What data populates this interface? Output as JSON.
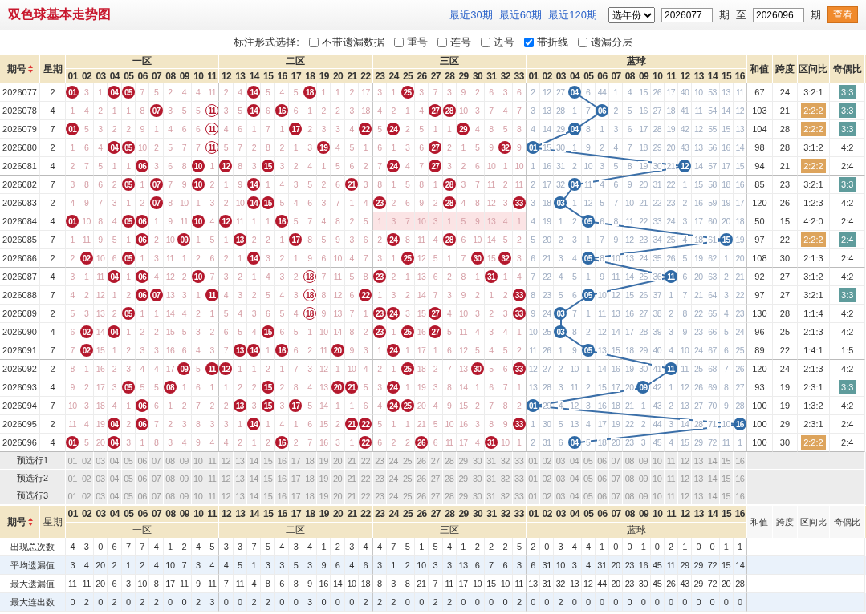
{
  "title": "双色球基本走势图",
  "range_links": [
    "最近30期",
    "最近60期",
    "最近120期"
  ],
  "year_select": "选年份",
  "from": {
    "value": "2026077",
    "unit": "期"
  },
  "to": {
    "label": "至",
    "value": "2026096",
    "unit": "期"
  },
  "view_button": "查看",
  "options": {
    "label": "标注形式选择:",
    "items": [
      {
        "label": "不带遗漏数据",
        "checked": false
      },
      {
        "label": "重号",
        "checked": false
      },
      {
        "label": "连号",
        "checked": false
      },
      {
        "label": "边号",
        "checked": false
      },
      {
        "label": "带折线",
        "checked": true
      },
      {
        "label": "遗漏分层",
        "checked": false
      }
    ]
  },
  "header": {
    "period": "期号",
    "weekday": "星期",
    "zones": [
      {
        "name": "一区",
        "numbers": [
          "01",
          "02",
          "03",
          "04",
          "05",
          "06",
          "07",
          "08",
          "09",
          "10",
          "11"
        ]
      },
      {
        "name": "二区",
        "numbers": [
          "12",
          "13",
          "14",
          "15",
          "16",
          "17",
          "18",
          "19",
          "20",
          "21",
          "22"
        ]
      },
      {
        "name": "三区",
        "numbers": [
          "23",
          "24",
          "25",
          "26",
          "27",
          "28",
          "29",
          "30",
          "31",
          "32",
          "33"
        ]
      },
      {
        "name": "蓝球",
        "numbers": [
          "01",
          "02",
          "03",
          "04",
          "05",
          "06",
          "07",
          "08",
          "09",
          "10",
          "11",
          "12",
          "13",
          "14",
          "15",
          "16"
        ]
      }
    ],
    "sum": "和值",
    "span": "跨度",
    "zone_ratio": "区间比",
    "odd_even": "奇偶比"
  },
  "rows": [
    {
      "period": "2026077",
      "weekday": "2",
      "red": [
        {
          "ball": "01",
          "ring": false
        },
        "3",
        "1",
        {
          "ball": "04",
          "ring": false
        },
        {
          "ball": "05",
          "ring": false
        },
        "7",
        "5",
        "2",
        "4",
        "4",
        "11",
        "2",
        "4",
        {
          "ball": "14",
          "ring": false
        },
        "5",
        "4",
        "5",
        {
          "ball": "18",
          "ring": false
        },
        "1",
        "1",
        "2",
        "17",
        "3",
        "1",
        {
          "ball": "25",
          "ring": false
        },
        "3",
        "7",
        "3",
        "9",
        "2",
        "6",
        "3",
        "6"
      ],
      "blue": [
        "2",
        "12",
        "27",
        {
          "ball": "04"
        },
        "6",
        "44",
        "1",
        "4",
        "15",
        "26",
        "17",
        "40",
        "10",
        "53",
        "13",
        "11"
      ],
      "blank_zone_3": false,
      "sum": "67",
      "span": "24",
      "zone_ratio": {
        "text": "3:2:1",
        "highlight": false
      },
      "odd_even": {
        "text": "3:3",
        "highlight": true
      }
    },
    {
      "period": "2026078",
      "weekday": "4",
      "red": [
        "1",
        "4",
        "2",
        "1",
        "1",
        "8",
        {
          "ball": "07",
          "ring": false
        },
        "3",
        "5",
        "5",
        {
          "ball": "11",
          "ring": true
        },
        "3",
        "5",
        {
          "ball": "14",
          "ring": false
        },
        "6",
        {
          "ball": "16",
          "ring": false
        },
        "6",
        "1",
        "2",
        "2",
        "3",
        "18",
        "4",
        "2",
        "1",
        "4",
        {
          "ball": "27",
          "ring": false
        },
        {
          "ball": "28",
          "ring": false
        },
        "10",
        "3",
        "7",
        "4",
        "7"
      ],
      "blue": [
        "3",
        "13",
        "28",
        "1",
        "7",
        {
          "ball": "06"
        },
        "2",
        "5",
        "16",
        "27",
        "18",
        "41",
        "11",
        "54",
        "14",
        "12"
      ],
      "blank_zone_3": false,
      "sum": "103",
      "span": "21",
      "zone_ratio": {
        "text": "2:2:2",
        "highlight": true
      },
      "odd_even": {
        "text": "3:3",
        "highlight": true
      }
    },
    {
      "period": "2026079",
      "weekday": "7",
      "red": [
        {
          "ball": "01",
          "ring": false
        },
        "5",
        "3",
        "2",
        "2",
        "9",
        "1",
        "4",
        "6",
        "6",
        {
          "ball": "11",
          "ring": true
        },
        "4",
        "6",
        "1",
        "7",
        "1",
        {
          "ball": "17",
          "ring": false
        },
        "2",
        "3",
        "3",
        "4",
        {
          "ball": "22",
          "ring": false
        },
        "5",
        {
          "ball": "24",
          "ring": false
        },
        "2",
        "5",
        "1",
        "1",
        {
          "ball": "29",
          "ring": false
        },
        "4",
        "8",
        "5",
        "8"
      ],
      "blue": [
        "4",
        "14",
        "29",
        {
          "ball": "04"
        },
        "8",
        "1",
        "3",
        "6",
        "17",
        "28",
        "19",
        "42",
        "12",
        "55",
        "15",
        "13"
      ],
      "blank_zone_3": false,
      "sum": "104",
      "span": "28",
      "zone_ratio": {
        "text": "2:2:2",
        "highlight": true
      },
      "odd_even": {
        "text": "3:3",
        "highlight": true
      }
    },
    {
      "period": "2026080",
      "weekday": "2",
      "red": [
        "1",
        "6",
        "4",
        {
          "ball": "04",
          "ring": false
        },
        {
          "ball": "05",
          "ring": false
        },
        "10",
        "2",
        "5",
        "7",
        "7",
        {
          "ball": "11",
          "ring": true
        },
        "5",
        "7",
        "2",
        "8",
        "2",
        "1",
        "3",
        {
          "ball": "19",
          "ring": false
        },
        "4",
        "5",
        "1",
        "6",
        "1",
        "3",
        "6",
        {
          "ball": "27",
          "ring": false
        },
        "2",
        "1",
        "5",
        "9",
        {
          "ball": "32",
          "ring": false
        },
        "9"
      ],
      "blue": [
        {
          "ball": "01"
        },
        "15",
        "30",
        "1",
        "9",
        "2",
        "4",
        "7",
        "18",
        "29",
        "20",
        "43",
        "13",
        "56",
        "16",
        "14"
      ],
      "blank_zone_3": false,
      "sum": "98",
      "span": "28",
      "zone_ratio": {
        "text": "3:1:2",
        "highlight": false
      },
      "odd_even": {
        "text": "4:2",
        "highlight": false
      }
    },
    {
      "period": "2026081",
      "weekday": "4",
      "red": [
        "2",
        "7",
        "5",
        "1",
        "1",
        {
          "ball": "06",
          "ring": false
        },
        "3",
        "6",
        "8",
        {
          "ball": "10",
          "ring": false
        },
        "1",
        {
          "ball": "12",
          "ring": false
        },
        "8",
        "3",
        {
          "ball": "15",
          "ring": false
        },
        "3",
        "2",
        "4",
        "1",
        "5",
        "6",
        "2",
        "7",
        {
          "ball": "24",
          "ring": false
        },
        "4",
        "7",
        {
          "ball": "27",
          "ring": false
        },
        "3",
        "2",
        "6",
        "10",
        "1",
        "10"
      ],
      "blue": [
        "1",
        "16",
        "31",
        "2",
        "10",
        "3",
        "5",
        "8",
        "19",
        "30",
        "21",
        {
          "ball": "12"
        },
        "14",
        "57",
        "17",
        "15"
      ],
      "blank_zone_3": false,
      "sum": "94",
      "span": "21",
      "zone_ratio": {
        "text": "2:2:2",
        "highlight": true
      },
      "odd_even": {
        "text": "2:4",
        "highlight": false
      }
    },
    {
      "period": "2026082",
      "weekday": "7",
      "red": [
        "3",
        "8",
        "6",
        "2",
        {
          "ball": "05",
          "ring": false
        },
        "1",
        {
          "ball": "07",
          "ring": false
        },
        "7",
        "9",
        {
          "ball": "10",
          "ring": false
        },
        "2",
        "1",
        "9",
        {
          "ball": "14",
          "ring": false
        },
        "1",
        "4",
        "3",
        "5",
        "2",
        "6",
        {
          "ball": "21",
          "ring": false
        },
        "3",
        "8",
        "1",
        "5",
        "8",
        "1",
        {
          "ball": "28",
          "ring": false
        },
        "3",
        "7",
        "11",
        "2",
        "11"
      ],
      "blue": [
        "2",
        "17",
        "32",
        {
          "ball": "04"
        },
        "11",
        "4",
        "6",
        "9",
        "20",
        "31",
        "22",
        "1",
        "15",
        "58",
        "18",
        "16"
      ],
      "blank_zone_3": false,
      "sum": "85",
      "span": "23",
      "zone_ratio": {
        "text": "3:2:1",
        "highlight": false
      },
      "odd_even": {
        "text": "3:3",
        "highlight": true
      }
    },
    {
      "period": "2026083",
      "weekday": "2",
      "red": [
        "4",
        "9",
        "7",
        "3",
        "1",
        "2",
        {
          "ball": "07",
          "ring": false
        },
        "8",
        "10",
        "1",
        "3",
        "2",
        "10",
        {
          "ball": "14",
          "ring": false
        },
        {
          "ball": "15",
          "ring": false
        },
        "5",
        "4",
        "6",
        "3",
        "7",
        "1",
        "4",
        {
          "ball": "23",
          "ring": false
        },
        "2",
        "6",
        "9",
        "2",
        {
          "ball": "28",
          "ring": false
        },
        "4",
        "8",
        "12",
        "3",
        {
          "ball": "33",
          "ring": false
        }
      ],
      "blue": [
        "3",
        "18",
        {
          "ball": "03"
        },
        "1",
        "12",
        "5",
        "7",
        "10",
        "21",
        "22",
        "23",
        "2",
        "16",
        "59",
        "19",
        "17"
      ],
      "blank_zone_3": false,
      "sum": "120",
      "span": "26",
      "zone_ratio": {
        "text": "1:2:3",
        "highlight": false
      },
      "odd_even": {
        "text": "4:2",
        "highlight": false
      }
    },
    {
      "period": "2026084",
      "weekday": "4",
      "red": [
        {
          "ball": "01",
          "ring": false
        },
        "10",
        "8",
        "4",
        {
          "ball": "05",
          "ring": false
        },
        {
          "ball": "06",
          "ring": false
        },
        "1",
        "9",
        "11",
        {
          "ball": "10",
          "ring": false
        },
        "4",
        {
          "ball": "12",
          "ring": false
        },
        "11",
        "1",
        "1",
        {
          "ball": "16",
          "ring": false
        },
        "5",
        "7",
        "4",
        "8",
        "2",
        "5",
        "1",
        "3",
        "7",
        "10",
        "3",
        "1",
        "5",
        "9",
        "13",
        "4",
        "1"
      ],
      "blue": [
        "4",
        "19",
        "1",
        "2",
        {
          "ball": "05"
        },
        "6",
        "8",
        "11",
        "22",
        "33",
        "24",
        "3",
        "17",
        "60",
        "20",
        "18"
      ],
      "blank_zone_3": true,
      "sum": "50",
      "span": "15",
      "zone_ratio": {
        "text": "4:2:0",
        "highlight": false
      },
      "odd_even": {
        "text": "2:4",
        "highlight": false
      }
    },
    {
      "period": "2026085",
      "weekday": "7",
      "red": [
        "1",
        "11",
        "9",
        "5",
        "1",
        {
          "ball": "06",
          "ring": false
        },
        "2",
        "10",
        {
          "ball": "09",
          "ring": false
        },
        "1",
        "5",
        "1",
        {
          "ball": "13",
          "ring": false
        },
        "2",
        "2",
        "1",
        {
          "ball": "17",
          "ring": false
        },
        "8",
        "5",
        "9",
        "3",
        "6",
        "2",
        {
          "ball": "24",
          "ring": false
        },
        "8",
        "11",
        "4",
        {
          "ball": "28",
          "ring": false
        },
        "6",
        "10",
        "14",
        "5",
        "2"
      ],
      "blue": [
        "5",
        "20",
        "2",
        "3",
        "1",
        "7",
        "9",
        "12",
        "23",
        "34",
        "25",
        "4",
        "18",
        "61",
        {
          "ball": "15"
        },
        "19"
      ],
      "blank_zone_3": false,
      "sum": "97",
      "span": "22",
      "zone_ratio": {
        "text": "2:2:2",
        "highlight": true
      },
      "odd_even": {
        "text": "2:4",
        "highlight": true
      }
    },
    {
      "period": "2026086",
      "weekday": "2",
      "red": [
        "2",
        {
          "ball": "02",
          "ring": false
        },
        "10",
        "6",
        {
          "ball": "05",
          "ring": false
        },
        "1",
        "3",
        "11",
        "1",
        "2",
        "6",
        "2",
        "1",
        {
          "ball": "14",
          "ring": false
        },
        "3",
        "2",
        "1",
        "9",
        "6",
        "10",
        "4",
        "7",
        "3",
        "1",
        {
          "ball": "25",
          "ring": false
        },
        "12",
        "5",
        "1",
        "7",
        {
          "ball": "30",
          "ring": false
        },
        "15",
        {
          "ball": "32",
          "ring": false
        },
        "3"
      ],
      "blue": [
        "6",
        "21",
        "3",
        "4",
        {
          "ball": "05"
        },
        "8",
        "10",
        "13",
        "24",
        "35",
        "26",
        "5",
        "19",
        "62",
        "1",
        "20"
      ],
      "blank_zone_3": false,
      "sum": "108",
      "span": "30",
      "zone_ratio": {
        "text": "2:1:3",
        "highlight": false
      },
      "odd_even": {
        "text": "2:4",
        "highlight": false
      }
    },
    {
      "period": "2026087",
      "weekday": "4",
      "red": [
        "3",
        "1",
        "11",
        {
          "ball": "04",
          "ring": false
        },
        "1",
        {
          "ball": "06",
          "ring": false
        },
        "4",
        "12",
        "2",
        {
          "ball": "10",
          "ring": false
        },
        "7",
        "3",
        "2",
        "1",
        "4",
        "3",
        "2",
        {
          "ball": "18",
          "ring": true
        },
        "7",
        "11",
        "5",
        "8",
        {
          "ball": "23",
          "ring": false
        },
        "2",
        "1",
        "13",
        "6",
        "2",
        "8",
        "1",
        {
          "ball": "31",
          "ring": false
        },
        "1",
        "4"
      ],
      "blue": [
        "7",
        "22",
        "4",
        "5",
        "1",
        "9",
        "11",
        "14",
        "25",
        "36",
        {
          "ball": "11"
        },
        "6",
        "20",
        "63",
        "2",
        "21"
      ],
      "blank_zone_3": false,
      "sum": "92",
      "span": "27",
      "zone_ratio": {
        "text": "3:1:2",
        "highlight": false
      },
      "odd_even": {
        "text": "4:2",
        "highlight": false
      }
    },
    {
      "period": "2026088",
      "weekday": "7",
      "red": [
        "4",
        "2",
        "12",
        "1",
        "2",
        {
          "ball": "06",
          "ring": false
        },
        {
          "ball": "07",
          "ring": false
        },
        "13",
        "3",
        "1",
        {
          "ball": "11",
          "ring": false
        },
        "4",
        "3",
        "2",
        "5",
        "4",
        "3",
        {
          "ball": "18",
          "ring": true
        },
        "8",
        "12",
        "6",
        {
          "ball": "22",
          "ring": false
        },
        "1",
        "3",
        "2",
        "14",
        "7",
        "3",
        "9",
        "2",
        "1",
        "2",
        {
          "ball": "33",
          "ring": false
        }
      ],
      "blue": [
        "8",
        "23",
        "5",
        "6",
        {
          "ball": "05"
        },
        "10",
        "12",
        "15",
        "26",
        "37",
        "1",
        "7",
        "21",
        "64",
        "3",
        "22"
      ],
      "blank_zone_3": false,
      "sum": "97",
      "span": "27",
      "zone_ratio": {
        "text": "3:2:1",
        "highlight": false
      },
      "odd_even": {
        "text": "3:3",
        "highlight": true
      }
    },
    {
      "period": "2026089",
      "weekday": "2",
      "red": [
        "5",
        "3",
        "13",
        "2",
        {
          "ball": "05",
          "ring": false
        },
        "1",
        "1",
        "14",
        "4",
        "2",
        "1",
        "5",
        "4",
        "3",
        "6",
        "5",
        "4",
        {
          "ball": "18",
          "ring": true
        },
        "9",
        "13",
        "7",
        "1",
        {
          "ball": "23",
          "ring": false
        },
        {
          "ball": "24",
          "ring": false
        },
        "3",
        "15",
        {
          "ball": "27",
          "ring": false
        },
        "4",
        "10",
        "3",
        "2",
        "3",
        {
          "ball": "33",
          "ring": false
        }
      ],
      "blue": [
        "9",
        "24",
        {
          "ball": "03"
        },
        "7",
        "1",
        "11",
        "13",
        "16",
        "27",
        "38",
        "2",
        "8",
        "22",
        "65",
        "4",
        "23"
      ],
      "blank_zone_3": false,
      "sum": "130",
      "span": "28",
      "zone_ratio": {
        "text": "1:1:4",
        "highlight": false
      },
      "odd_even": {
        "text": "4:2",
        "highlight": false
      }
    },
    {
      "period": "2026090",
      "weekday": "4",
      "red": [
        "6",
        {
          "ball": "02",
          "ring": false
        },
        "14",
        {
          "ball": "04",
          "ring": false
        },
        "1",
        "2",
        "2",
        "15",
        "5",
        "3",
        "2",
        "6",
        "5",
        "4",
        {
          "ball": "15",
          "ring": false
        },
        "6",
        "5",
        "1",
        "10",
        "14",
        "8",
        "2",
        {
          "ball": "23",
          "ring": false
        },
        "1",
        {
          "ball": "25",
          "ring": false
        },
        "16",
        {
          "ball": "27",
          "ring": false
        },
        "5",
        "11",
        "4",
        "3",
        "4",
        "1"
      ],
      "blue": [
        "10",
        "25",
        {
          "ball": "03"
        },
        "8",
        "2",
        "12",
        "14",
        "17",
        "28",
        "39",
        "3",
        "9",
        "23",
        "66",
        "5",
        "24"
      ],
      "blank_zone_3": false,
      "sum": "96",
      "span": "25",
      "zone_ratio": {
        "text": "2:1:3",
        "highlight": false
      },
      "odd_even": {
        "text": "4:2",
        "highlight": false
      }
    },
    {
      "period": "2026091",
      "weekday": "7",
      "red": [
        "7",
        {
          "ball": "02",
          "ring": false
        },
        "15",
        "1",
        "2",
        "3",
        "3",
        "16",
        "6",
        "4",
        "3",
        "7",
        {
          "ball": "13",
          "ring": false
        },
        {
          "ball": "14",
          "ring": false
        },
        "1",
        {
          "ball": "16",
          "ring": false
        },
        "6",
        "2",
        "11",
        {
          "ball": "20",
          "ring": false
        },
        "9",
        "3",
        "1",
        {
          "ball": "24",
          "ring": false
        },
        "1",
        "17",
        "1",
        "6",
        "12",
        "5",
        "4",
        "5",
        "2"
      ],
      "blue": [
        "11",
        "26",
        "1",
        "9",
        {
          "ball": "05"
        },
        "13",
        "15",
        "18",
        "29",
        "40",
        "4",
        "10",
        "24",
        "67",
        "6",
        "25"
      ],
      "blank_zone_3": false,
      "sum": "89",
      "span": "22",
      "zone_ratio": {
        "text": "1:4:1",
        "highlight": false
      },
      "odd_even": {
        "text": "1:5",
        "highlight": false
      }
    },
    {
      "period": "2026092",
      "weekday": "2",
      "red": [
        "8",
        "1",
        "16",
        "2",
        "3",
        "4",
        "4",
        "17",
        {
          "ball": "09",
          "ring": false
        },
        "5",
        {
          "ball": "11",
          "ring": false
        },
        {
          "ball": "12",
          "ring": false
        },
        "1",
        "1",
        "2",
        "1",
        "7",
        "3",
        "12",
        "1",
        "10",
        "4",
        "2",
        "1",
        {
          "ball": "25",
          "ring": false
        },
        "18",
        "2",
        "7",
        "13",
        {
          "ball": "30",
          "ring": false
        },
        "5",
        "6",
        {
          "ball": "33",
          "ring": false
        }
      ],
      "blue": [
        "12",
        "27",
        "2",
        "10",
        "1",
        "14",
        "16",
        "19",
        "30",
        "41",
        {
          "ball": "11"
        },
        "11",
        "25",
        "68",
        "7",
        "26"
      ],
      "blank_zone_3": false,
      "sum": "120",
      "span": "24",
      "zone_ratio": {
        "text": "2:1:3",
        "highlight": false
      },
      "odd_even": {
        "text": "4:2",
        "highlight": false
      }
    },
    {
      "period": "2026093",
      "weekday": "4",
      "red": [
        "9",
        "2",
        "17",
        "3",
        {
          "ball": "05",
          "ring": false
        },
        "5",
        "5",
        {
          "ball": "08",
          "ring": false
        },
        "1",
        "6",
        "1",
        "1",
        "2",
        "2",
        {
          "ball": "15",
          "ring": false
        },
        "2",
        "8",
        "4",
        "13",
        {
          "ball": "20",
          "ring": false
        },
        {
          "ball": "21",
          "ring": false
        },
        "5",
        "3",
        {
          "ball": "24",
          "ring": false
        },
        "1",
        "19",
        "3",
        "8",
        "14",
        "1",
        "6",
        "7",
        "1"
      ],
      "blue": [
        "13",
        "28",
        "3",
        "11",
        "2",
        "15",
        "17",
        "20",
        {
          "ball": "09"
        },
        "42",
        "1",
        "12",
        "26",
        "69",
        "8",
        "27"
      ],
      "blank_zone_3": false,
      "sum": "93",
      "span": "19",
      "zone_ratio": {
        "text": "2:3:1",
        "highlight": false
      },
      "odd_even": {
        "text": "3:3",
        "highlight": true
      }
    },
    {
      "period": "2026094",
      "weekday": "7",
      "red": [
        "10",
        "3",
        "18",
        "4",
        "1",
        {
          "ball": "06",
          "ring": false
        },
        "6",
        "1",
        "2",
        "7",
        "2",
        "2",
        {
          "ball": "13",
          "ring": false
        },
        "3",
        {
          "ball": "15",
          "ring": false
        },
        "3",
        {
          "ball": "17",
          "ring": false
        },
        "5",
        "14",
        "1",
        "1",
        "6",
        "4",
        {
          "ball": "24",
          "ring": false
        },
        {
          "ball": "25",
          "ring": false
        },
        "20",
        "4",
        "9",
        "15",
        "2",
        "7",
        "8",
        "2"
      ],
      "blue": [
        {
          "ball": "01"
        },
        "29",
        "4",
        "12",
        "3",
        "16",
        "18",
        "21",
        "1",
        "43",
        "2",
        "13",
        "27",
        "70",
        "9",
        "28"
      ],
      "blank_zone_3": false,
      "sum": "100",
      "span": "19",
      "zone_ratio": {
        "text": "1:3:2",
        "highlight": false
      },
      "odd_even": {
        "text": "4:2",
        "highlight": false
      }
    },
    {
      "period": "2026095",
      "weekday": "2",
      "red": [
        "11",
        "4",
        "19",
        {
          "ball": "04",
          "ring": false
        },
        "2",
        {
          "ball": "06",
          "ring": false
        },
        "7",
        "2",
        "3",
        "8",
        "3",
        "3",
        "1",
        {
          "ball": "14",
          "ring": false
        },
        "1",
        "4",
        "1",
        "6",
        "15",
        "2",
        {
          "ball": "21",
          "ring": false
        },
        {
          "ball": "22",
          "ring": false
        },
        "5",
        "1",
        "1",
        "21",
        "5",
        "10",
        "16",
        "3",
        "8",
        "9",
        {
          "ball": "33",
          "ring": false
        }
      ],
      "blue": [
        "1",
        "30",
        "5",
        "13",
        "4",
        "17",
        "19",
        "22",
        "2",
        "44",
        "3",
        "14",
        "28",
        "71",
        "10",
        {
          "ball": "16"
        }
      ],
      "blank_zone_3": false,
      "sum": "100",
      "span": "29",
      "zone_ratio": {
        "text": "2:3:1",
        "highlight": false
      },
      "odd_even": {
        "text": "2:4",
        "highlight": false
      }
    },
    {
      "period": "2026096",
      "weekday": "4",
      "red": [
        {
          "ball": "01",
          "ring": false
        },
        "5",
        "20",
        {
          "ball": "04",
          "ring": false
        },
        "3",
        "1",
        "8",
        "3",
        "4",
        "9",
        "4",
        "4",
        "2",
        "1",
        "2",
        {
          "ball": "16",
          "ring": false
        },
        "2",
        "7",
        "16",
        "3",
        "1",
        {
          "ball": "22",
          "ring": false
        },
        "6",
        "2",
        "2",
        {
          "ball": "26",
          "ring": false
        },
        "6",
        "11",
        "17",
        "4",
        {
          "ball": "31",
          "ring": false
        },
        "10",
        "1"
      ],
      "blue": [
        "2",
        "31",
        "6",
        {
          "ball": "04"
        },
        "5",
        "18",
        "20",
        "23",
        "3",
        "45",
        "4",
        "15",
        "29",
        "72",
        "11",
        "1"
      ],
      "blank_zone_3": false,
      "sum": "100",
      "span": "30",
      "zone_ratio": {
        "text": "2:2:2",
        "highlight": true
      },
      "odd_even": {
        "text": "2:4",
        "highlight": false
      }
    }
  ],
  "preselect": [
    {
      "label": "预选行1",
      "numbers": [
        "01",
        "02",
        "03",
        "04",
        "05",
        "06",
        "07",
        "08",
        "09",
        "10",
        "11",
        "12",
        "13",
        "14",
        "15",
        "16",
        "17",
        "18",
        "19",
        "20",
        "21",
        "22",
        "23",
        "24",
        "25",
        "26",
        "27",
        "28",
        "29",
        "30",
        "31",
        "32",
        "33",
        "01",
        "02",
        "03",
        "04",
        "05",
        "06",
        "07",
        "08",
        "09",
        "10",
        "11",
        "12",
        "13",
        "14",
        "15",
        "16"
      ]
    },
    {
      "label": "预选行2",
      "numbers": [
        "01",
        "02",
        "03",
        "04",
        "05",
        "06",
        "07",
        "08",
        "09",
        "10",
        "11",
        "12",
        "13",
        "14",
        "15",
        "16",
        "17",
        "18",
        "19",
        "20",
        "21",
        "22",
        "23",
        "24",
        "25",
        "26",
        "27",
        "28",
        "29",
        "30",
        "31",
        "32",
        "33",
        "01",
        "02",
        "03",
        "04",
        "05",
        "06",
        "07",
        "08",
        "09",
        "10",
        "11",
        "12",
        "13",
        "14",
        "15",
        "16"
      ]
    },
    {
      "label": "预选行3",
      "numbers": [
        "01",
        "02",
        "03",
        "04",
        "05",
        "06",
        "07",
        "08",
        "09",
        "10",
        "11",
        "12",
        "13",
        "14",
        "15",
        "16",
        "17",
        "18",
        "19",
        "20",
        "21",
        "22",
        "23",
        "24",
        "25",
        "26",
        "27",
        "28",
        "29",
        "30",
        "31",
        "32",
        "33",
        "01",
        "02",
        "03",
        "04",
        "05",
        "06",
        "07",
        "08",
        "09",
        "10",
        "11",
        "12",
        "13",
        "14",
        "15",
        "16"
      ]
    }
  ],
  "footer_header": {
    "period": "期号",
    "weekday": "星期",
    "zones": [
      {
        "name": "一区",
        "numbers": [
          "01",
          "02",
          "03",
          "04",
          "05",
          "06",
          "07",
          "08",
          "09",
          "10",
          "11"
        ]
      },
      {
        "name": "二区",
        "numbers": [
          "12",
          "13",
          "14",
          "15",
          "16",
          "17",
          "18",
          "19",
          "20",
          "21",
          "22"
        ]
      },
      {
        "name": "三区",
        "numbers": [
          "23",
          "24",
          "25",
          "26",
          "27",
          "28",
          "29",
          "30",
          "31",
          "32",
          "33"
        ]
      },
      {
        "name": "蓝球",
        "numbers": [
          "01",
          "02",
          "03",
          "04",
          "05",
          "06",
          "07",
          "08",
          "09",
          "10",
          "11",
          "12",
          "13",
          "14",
          "15",
          "16"
        ]
      }
    ],
    "sum": "和值",
    "span": "跨度",
    "zone_ratio": "区间比",
    "odd_even": "奇偶比"
  },
  "stats": [
    {
      "label": "出现总次数",
      "values": [
        "4",
        "3",
        "0",
        "6",
        "7",
        "7",
        "4",
        "1",
        "2",
        "4",
        "5",
        "3",
        "3",
        "7",
        "5",
        "4",
        "3",
        "4",
        "1",
        "2",
        "3",
        "4",
        "4",
        "7",
        "5",
        "1",
        "5",
        "4",
        "1",
        "2",
        "2",
        "2",
        "5",
        "2",
        "0",
        "3",
        "4",
        "4",
        "1",
        "0",
        "0",
        "1",
        "0",
        "2",
        "1",
        "0",
        "0",
        "1",
        "1"
      ]
    },
    {
      "label": "平均遗漏值",
      "values": [
        "3",
        "4",
        "20",
        "2",
        "1",
        "2",
        "4",
        "10",
        "7",
        "3",
        "4",
        "4",
        "5",
        "1",
        "3",
        "3",
        "5",
        "3",
        "9",
        "6",
        "4",
        "6",
        "3",
        "1",
        "2",
        "10",
        "3",
        "3",
        "13",
        "6",
        "7",
        "6",
        "3",
        "6",
        "31",
        "10",
        "3",
        "4",
        "31",
        "20",
        "23",
        "16",
        "45",
        "11",
        "29",
        "29",
        "72",
        "15",
        "14"
      ]
    },
    {
      "label": "最大遗漏值",
      "values": [
        "11",
        "11",
        "20",
        "6",
        "3",
        "10",
        "8",
        "17",
        "11",
        "9",
        "11",
        "7",
        "11",
        "4",
        "8",
        "6",
        "8",
        "9",
        "16",
        "14",
        "10",
        "18",
        "8",
        "3",
        "8",
        "21",
        "7",
        "11",
        "17",
        "10",
        "15",
        "10",
        "11",
        "13",
        "31",
        "32",
        "13",
        "12",
        "44",
        "20",
        "23",
        "30",
        "45",
        "26",
        "43",
        "29",
        "72",
        "20",
        "28"
      ]
    },
    {
      "label": "最大连出数",
      "values": [
        "0",
        "2",
        "0",
        "2",
        "0",
        "2",
        "2",
        "0",
        "0",
        "2",
        "3",
        "0",
        "0",
        "2",
        "2",
        "0",
        "0",
        "3",
        "0",
        "0",
        "0",
        "2",
        "2",
        "2",
        "0",
        "0",
        "2",
        "2",
        "0",
        "0",
        "0",
        "0",
        "2",
        "0",
        "0",
        "2",
        "0",
        "0",
        "0",
        "0",
        "0",
        "0",
        "0",
        "0",
        "0",
        "0",
        "0",
        "0",
        "0"
      ]
    }
  ]
}
